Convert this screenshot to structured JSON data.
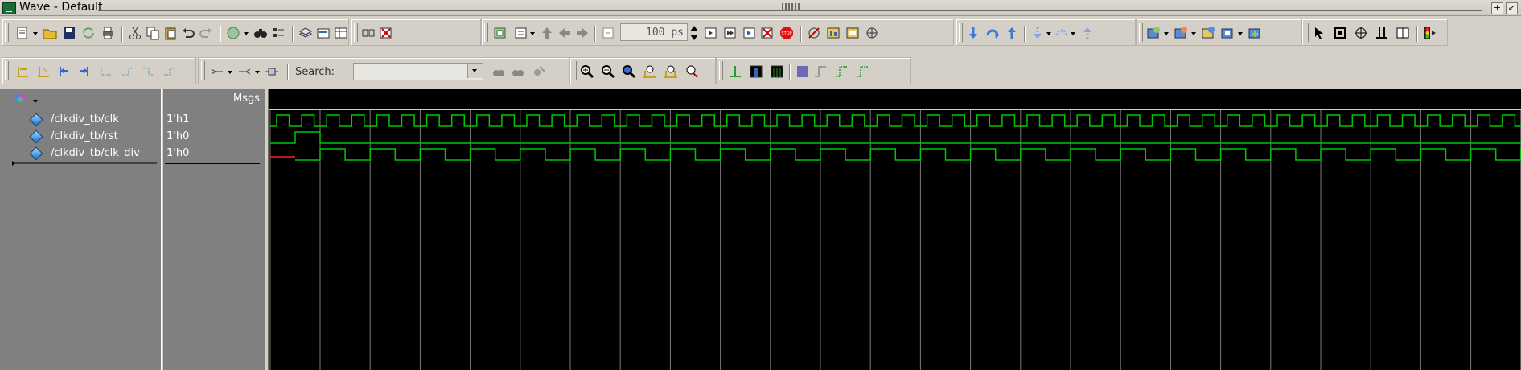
{
  "window": {
    "title": "Wave - Default",
    "controls": [
      "+",
      "↙"
    ]
  },
  "toolbar": {
    "time_step_value": "100 ps",
    "search_label": "Search:",
    "search_value": ""
  },
  "wave": {
    "header": {
      "values_title": "Msgs"
    },
    "signals": [
      {
        "name": "/clkdiv_tb/clk",
        "value": "1'h1"
      },
      {
        "name": "/clkdiv_tb/rst",
        "value": "1'h0"
      },
      {
        "name": "/clkdiv_tb/clk_div",
        "value": "1'h0"
      }
    ],
    "colors": {
      "waveform": "#00c800",
      "unknown": "#ff2020",
      "background": "#000000",
      "gridline": "#7a7a7a",
      "pane_bg": "#808080"
    }
  }
}
